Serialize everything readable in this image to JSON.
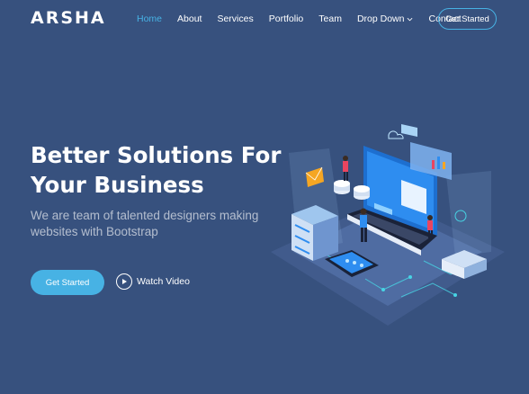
{
  "header": {
    "logo": "ARSHA",
    "nav": [
      {
        "label": "Home",
        "active": true
      },
      {
        "label": "About"
      },
      {
        "label": "Services"
      },
      {
        "label": "Portfolio"
      },
      {
        "label": "Team"
      },
      {
        "label": "Drop Down",
        "icon": "chevron-down-icon"
      },
      {
        "label": "Contact"
      }
    ],
    "cta": "Get Started"
  },
  "hero": {
    "title": "Better Solutions For Your Business",
    "subtitle": "We are team of talented designers making websites with Bootstrap",
    "cta": "Get Started",
    "watch_label": "Watch Video",
    "watch_icon": "play-icon"
  },
  "colors": {
    "background": "#37517e",
    "accent": "#47b2e4",
    "text": "#ffffff"
  }
}
